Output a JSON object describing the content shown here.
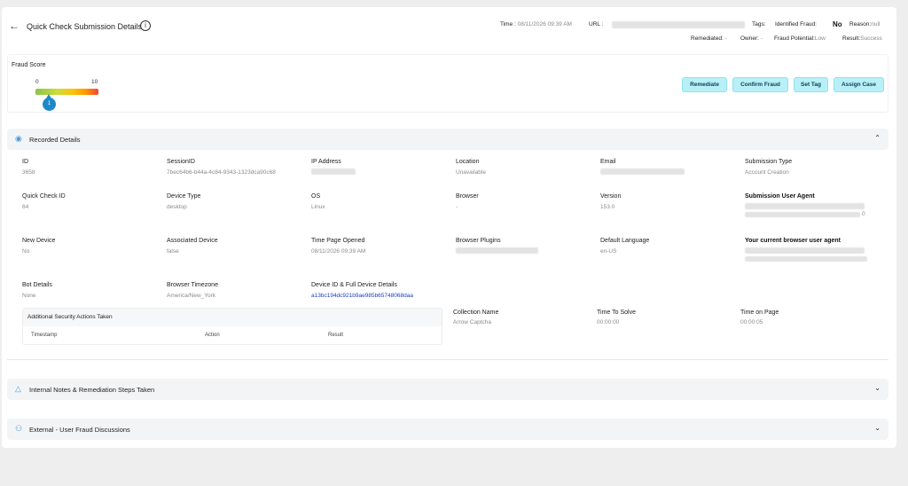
{
  "header": {
    "back_glyph": "←",
    "title": "Quick Check Submission Details",
    "info_glyph": "i",
    "time_label": "Time :",
    "time_value": "08/11/2026 09:39 AM",
    "url_label": "URL :",
    "tags_label": "Tags:",
    "identified_fraud_label": "Identified Fraud:",
    "identified_fraud_value": "No",
    "reason_label": "Reason:",
    "reason_value": "null",
    "remediated_label": "Remediated:",
    "remediated_value": "-",
    "owner_label": "Owner:",
    "owner_value": "-",
    "fraud_potential_label": "Fraud Potential:",
    "fraud_potential_value": "Low",
    "result_label": "Result:",
    "result_value": "Success"
  },
  "fraud_score": {
    "label": "Fraud Score",
    "min": "0",
    "max": "10",
    "value": "1"
  },
  "actions": {
    "remediate": "Remediate",
    "confirm_fraud": "Confirm Fraud",
    "set_tag": "Set Tag",
    "assign_case": "Assign Case"
  },
  "recorded": {
    "title": "Recorded Details",
    "fields": {
      "id_label": "ID",
      "id_value": "3658",
      "session_label": "SessionID",
      "session_value": "7bec64b6-b44a-4c84-9343-1323dca90c68",
      "ip_label": "IP Address",
      "location_label": "Location",
      "location_value": "Unavailable",
      "email_label": "Email",
      "submission_type_label": "Submission Type",
      "submission_type_value": "Account Creation",
      "qc_id_label": "Quick Check ID",
      "qc_id_value": "64",
      "device_type_label": "Device Type",
      "device_type_value": "desktop",
      "os_label": "OS",
      "os_value": "Linux",
      "browser_label": "Browser",
      "browser_value": "-",
      "version_label": "Version",
      "version_value": "153.0",
      "sub_ua_label": "Submission User Agent",
      "sub_ua_tail": "0",
      "new_device_label": "New Device",
      "new_device_value": "No",
      "assoc_device_label": "Associated Device",
      "assoc_device_value": "false",
      "time_opened_label": "Time Page Opened",
      "time_opened_value": "08/11/2026 09:39 AM",
      "plugins_label": "Browser Plugins",
      "default_lang_label": "Default Language",
      "default_lang_value": "en-US",
      "cur_ua_label": "Your current browser user agent",
      "bot_label": "Bot Details",
      "bot_value": "None",
      "tz_label": "Browser Timezone",
      "tz_value": "America/New_York",
      "device_full_label": "Device ID & Full Device Details",
      "device_full_value": "a13bc194dc921b9ae985b65748068daa",
      "collection_label": "Collection Name",
      "collection_value": "Arrow Captcha",
      "tts_label": "Time To Solve",
      "tts_value": "00:00:00",
      "top_label": "Time on Page",
      "top_value": "00:00:05"
    },
    "security_table": {
      "title": "Additional Security Actions Taken",
      "columns": [
        "Timestamp",
        "Action",
        "Result"
      ]
    }
  },
  "sections": {
    "notes_title": "Internal Notes & Remediation Steps Taken",
    "external_title": "External - User Fraud Discussions"
  }
}
